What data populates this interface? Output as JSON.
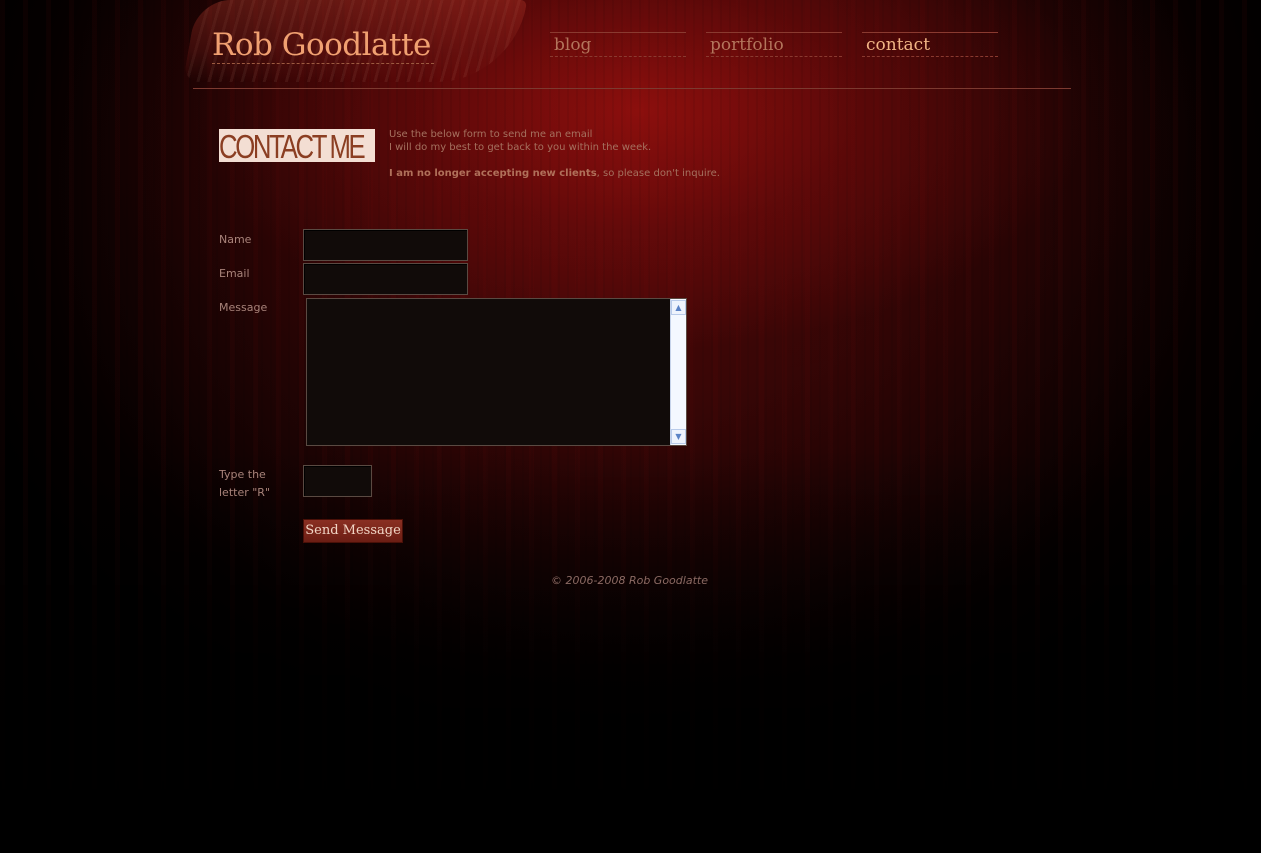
{
  "site": {
    "name": "Rob Goodlatte"
  },
  "nav": {
    "items": [
      {
        "label": "blog",
        "active": false
      },
      {
        "label": "portfolio",
        "active": false
      },
      {
        "label": "contact",
        "active": true
      }
    ]
  },
  "intro": {
    "heading": "CONTACT ME",
    "line1": "Use the below form to send me an email",
    "line2": "I will do my best to get back to you within the week.",
    "note_bold": "I am no longer accepting new clients",
    "note_rest": ", so please don't inquire."
  },
  "form": {
    "name_label": "Name",
    "email_label": "Email",
    "message_label": "Message",
    "captcha_label": "Type the letter \"R\"",
    "name_value": "",
    "email_value": "",
    "message_value": "",
    "captcha_value": "",
    "submit_label": "Send Message"
  },
  "footer": {
    "copyright": "© 2006-2008 Rob Goodlatte"
  },
  "colors": {
    "accent": "#f0a071",
    "background": "#3a0606",
    "button": "#7a2519"
  }
}
